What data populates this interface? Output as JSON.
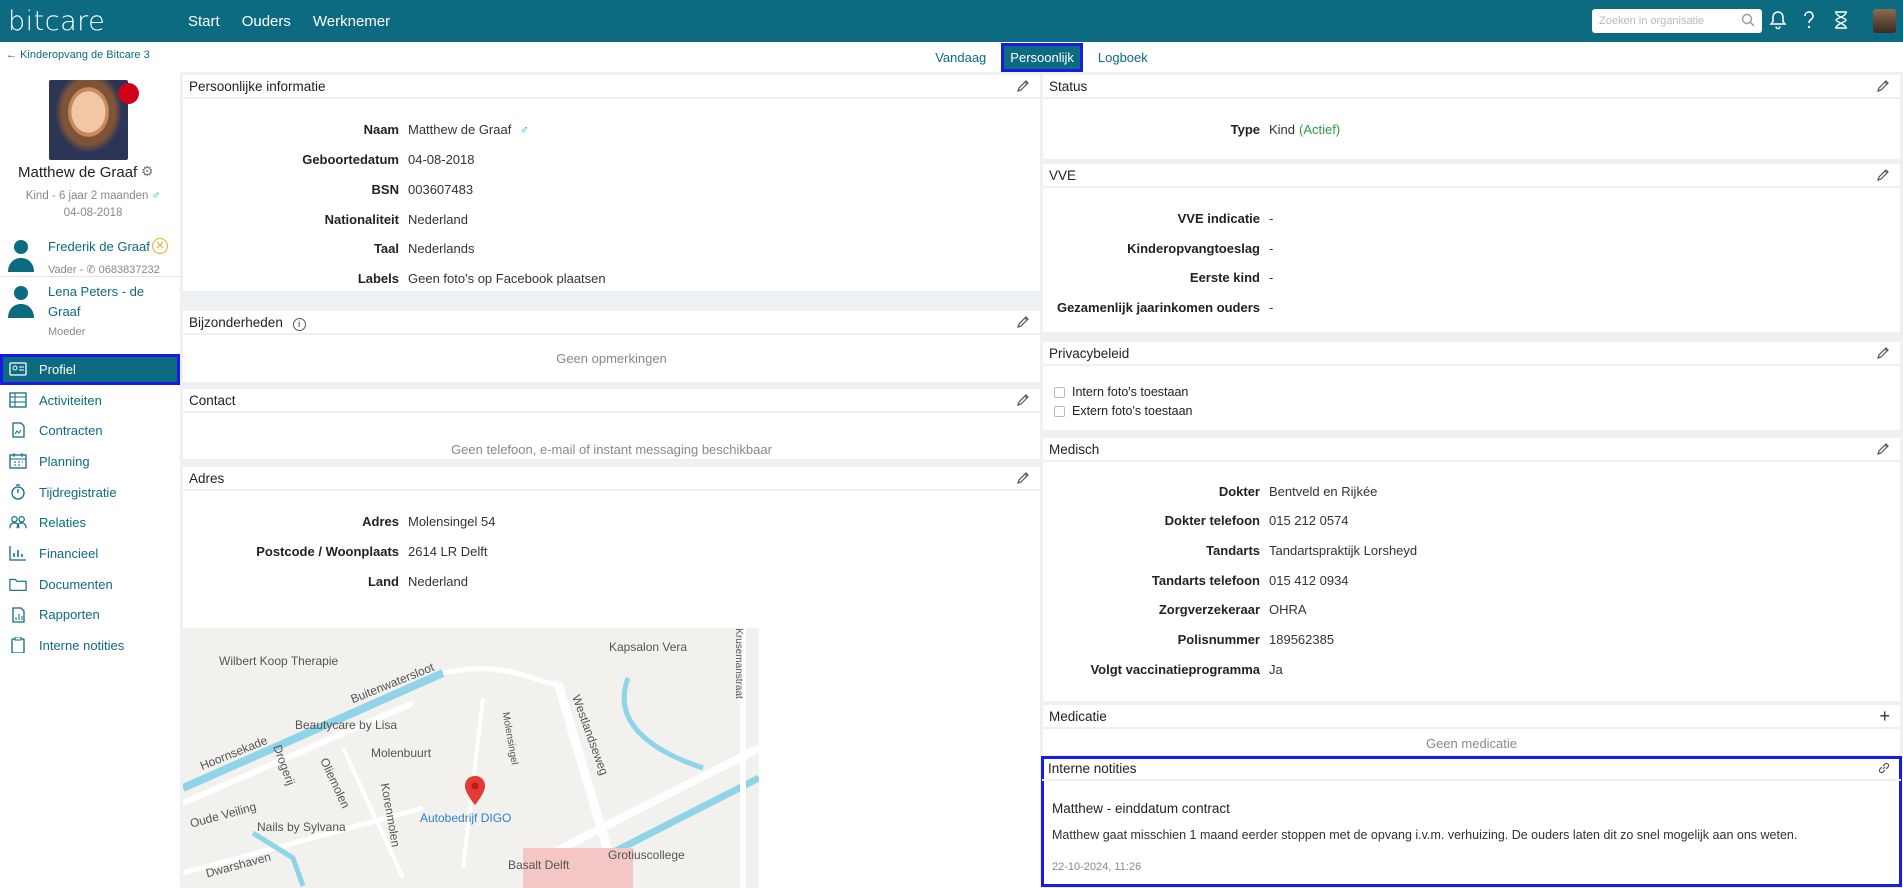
{
  "app": {
    "logo": "bitcare",
    "nav": [
      "Start",
      "Ouders",
      "Werknemer"
    ],
    "search_placeholder": "Zoeken in organisatie"
  },
  "sidebar": {
    "back": "Kinderopvang de Bitcare 3",
    "name": "Matthew de Graaf",
    "subtitle": "Kind - 6 jaar 2 maanden",
    "gender_symbol": "♂",
    "birthdate": "04-08-2018",
    "relations": [
      {
        "name": "Frederik de Graaf",
        "sub_role": "Vader -",
        "phone": "0683837232"
      },
      {
        "name": "Lena Peters - de Graaf",
        "sub_role": "Moeder"
      }
    ],
    "menu": [
      {
        "label": "Profiel",
        "icon": "id-card-icon"
      },
      {
        "label": "Activiteiten",
        "icon": "table-icon"
      },
      {
        "label": "Contracten",
        "icon": "contract-icon"
      },
      {
        "label": "Planning",
        "icon": "calendar-icon"
      },
      {
        "label": "Tijdregistratie",
        "icon": "stopwatch-icon"
      },
      {
        "label": "Relaties",
        "icon": "people-icon"
      },
      {
        "label": "Financieel",
        "icon": "bar-chart-icon"
      },
      {
        "label": "Documenten",
        "icon": "folder-icon"
      },
      {
        "label": "Rapporten",
        "icon": "report-icon"
      },
      {
        "label": "Interne notities",
        "icon": "clipboard-icon"
      }
    ]
  },
  "tabs": [
    "Vandaag",
    "Persoonlijk",
    "Logboek"
  ],
  "personal": {
    "title": "Persoonlijke informatie",
    "rows": [
      {
        "k": "Naam",
        "v": "Matthew de Graaf"
      },
      {
        "k": "Geboortedatum",
        "v": "04-08-2018"
      },
      {
        "k": "BSN",
        "v": "003607483"
      },
      {
        "k": "Nationaliteit",
        "v": "Nederland"
      },
      {
        "k": "Taal",
        "v": "Nederlands"
      },
      {
        "k": "Labels",
        "v": "Geen foto's op Facebook plaatsen"
      }
    ]
  },
  "bijzonderheden": {
    "title": "Bijzonderheden",
    "empty": "Geen opmerkingen"
  },
  "contact": {
    "title": "Contact",
    "empty": "Geen telefoon, e-mail of instant messaging beschikbaar"
  },
  "adres": {
    "title": "Adres",
    "rows": [
      {
        "k": "Adres",
        "v": "Molensingel 54"
      },
      {
        "k": "Postcode / Woonplaats",
        "v": "2614 LR Delft"
      },
      {
        "k": "Land",
        "v": "Nederland"
      }
    ]
  },
  "map": {
    "labels": [
      "Wilbert Koop Therapie",
      "Buitenwatersloot",
      "Beautycare by Lisa",
      "Molenbuurt",
      "Kapsalon Vera",
      "Westlandseweg",
      "Hoornsekade",
      "Drogerij",
      "Oliemolen",
      "Korenmolen",
      "Oude Veiling",
      "Nails by Sylvana",
      "Autobedrijf DIGO",
      "Dwarshaven",
      "Basalt Delft",
      "Grotiuscollege",
      "Molensingel",
      "Krusemanstraat"
    ]
  },
  "status": {
    "title": "Status",
    "k": "Type",
    "v": "Kind",
    "v2": "(Actief)"
  },
  "vve": {
    "title": "VVE",
    "rows": [
      {
        "k": "VVE indicatie",
        "v": "-"
      },
      {
        "k": "Kinderopvangtoeslag",
        "v": "-"
      },
      {
        "k": "Eerste kind",
        "v": "-"
      },
      {
        "k": "Gezamenlijk jaarinkomen ouders",
        "v": "-"
      }
    ]
  },
  "privacy": {
    "title": "Privacybeleid",
    "items": [
      "Intern foto's toestaan",
      "Extern foto's toestaan"
    ]
  },
  "medisch": {
    "title": "Medisch",
    "rows": [
      {
        "k": "Dokter",
        "v": "Bentveld en Rijkée"
      },
      {
        "k": "Dokter telefoon",
        "v": "015 212 0574"
      },
      {
        "k": "Tandarts",
        "v": "Tandartspraktijk Lorsheyd"
      },
      {
        "k": "Tandarts telefoon",
        "v": "015 412 0934"
      },
      {
        "k": "Zorgverzekeraar",
        "v": "OHRA"
      },
      {
        "k": "Polisnummer",
        "v": "189562385"
      },
      {
        "k": "Volgt vaccinatieprogramma",
        "v": "Ja"
      }
    ]
  },
  "medicatie": {
    "title": "Medicatie",
    "empty": "Geen medicatie"
  },
  "notities": {
    "title": "Interne notities",
    "note_title": "Matthew - einddatum contract",
    "note_body": "Matthew gaat misschien 1 maand eerder stoppen met de opvang i.v.m. verhuizing. De ouders laten dit zo snel mogelijk aan ons weten.",
    "note_date": "22-10-2024, 11:26"
  }
}
